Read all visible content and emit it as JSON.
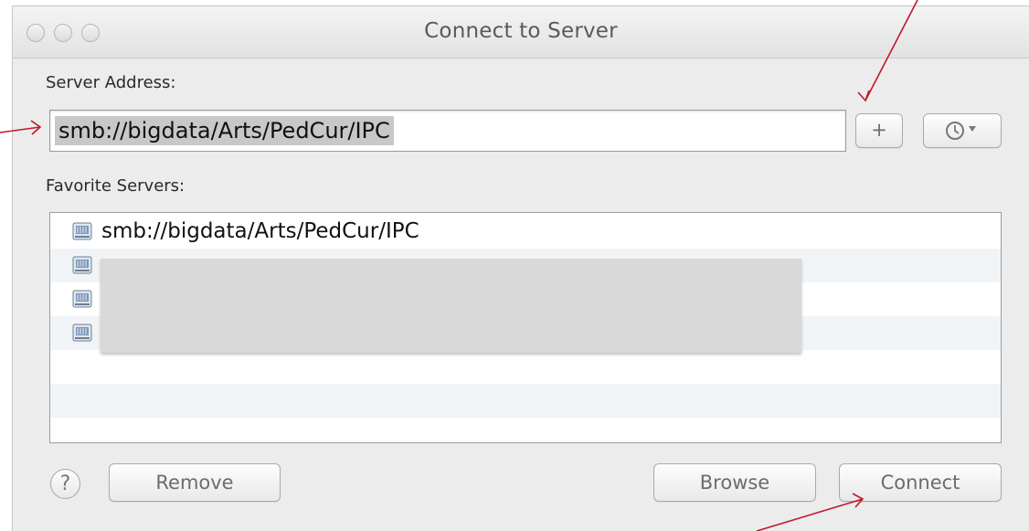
{
  "window": {
    "title": "Connect to Server"
  },
  "server_address": {
    "label": "Server Address:",
    "value": "smb://bigdata/Arts/PedCur/IPC"
  },
  "toolbar": {
    "add_label": "+",
    "recent_icon": "clock-icon"
  },
  "favorites": {
    "label": "Favorite Servers:",
    "items": [
      {
        "text": "smb://bigdata/Arts/PedCur/IPC",
        "icon": "server-icon"
      },
      {
        "text": "",
        "icon": "server-icon"
      },
      {
        "text": "",
        "icon": "server-icon"
      },
      {
        "text": "",
        "icon": "server-icon"
      }
    ]
  },
  "buttons": {
    "help": "?",
    "remove": "Remove",
    "browse": "Browse",
    "connect": "Connect"
  },
  "colors": {
    "annotation_arrow": "#c0182a"
  }
}
